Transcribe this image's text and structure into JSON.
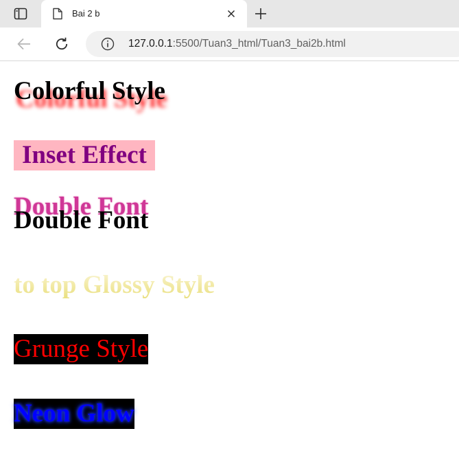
{
  "browser": {
    "tab": {
      "title": "Bai 2 b"
    },
    "address": {
      "host": "127.0.0.1",
      "rest": ":5500/Tuan3_html/Tuan3_bai2b.html"
    }
  },
  "page": {
    "colorful": "Colorful Style",
    "inset": "Inset Effect",
    "double_back": "Double Font",
    "double_front": "Double Font",
    "glossy": "to top Glossy Style",
    "grunge": "Grunge Style",
    "neon": "Neon Glow"
  },
  "colors": {
    "inset_text": "#800080",
    "inset_bg": "#ffb6c1",
    "colorful_shadow": "#ff2a2a",
    "double_back": "#c71585",
    "glossy": "#e8de7a",
    "grunge_text": "#ff0000",
    "neon_text": "#0000ff",
    "dark_bg": "#000000"
  },
  "icons": {
    "sidebar": "sidebar-toggle-icon",
    "file": "file-icon",
    "close": "close-icon",
    "new_tab": "plus-icon",
    "back": "back-arrow-icon",
    "reload": "reload-icon",
    "info": "info-icon"
  }
}
